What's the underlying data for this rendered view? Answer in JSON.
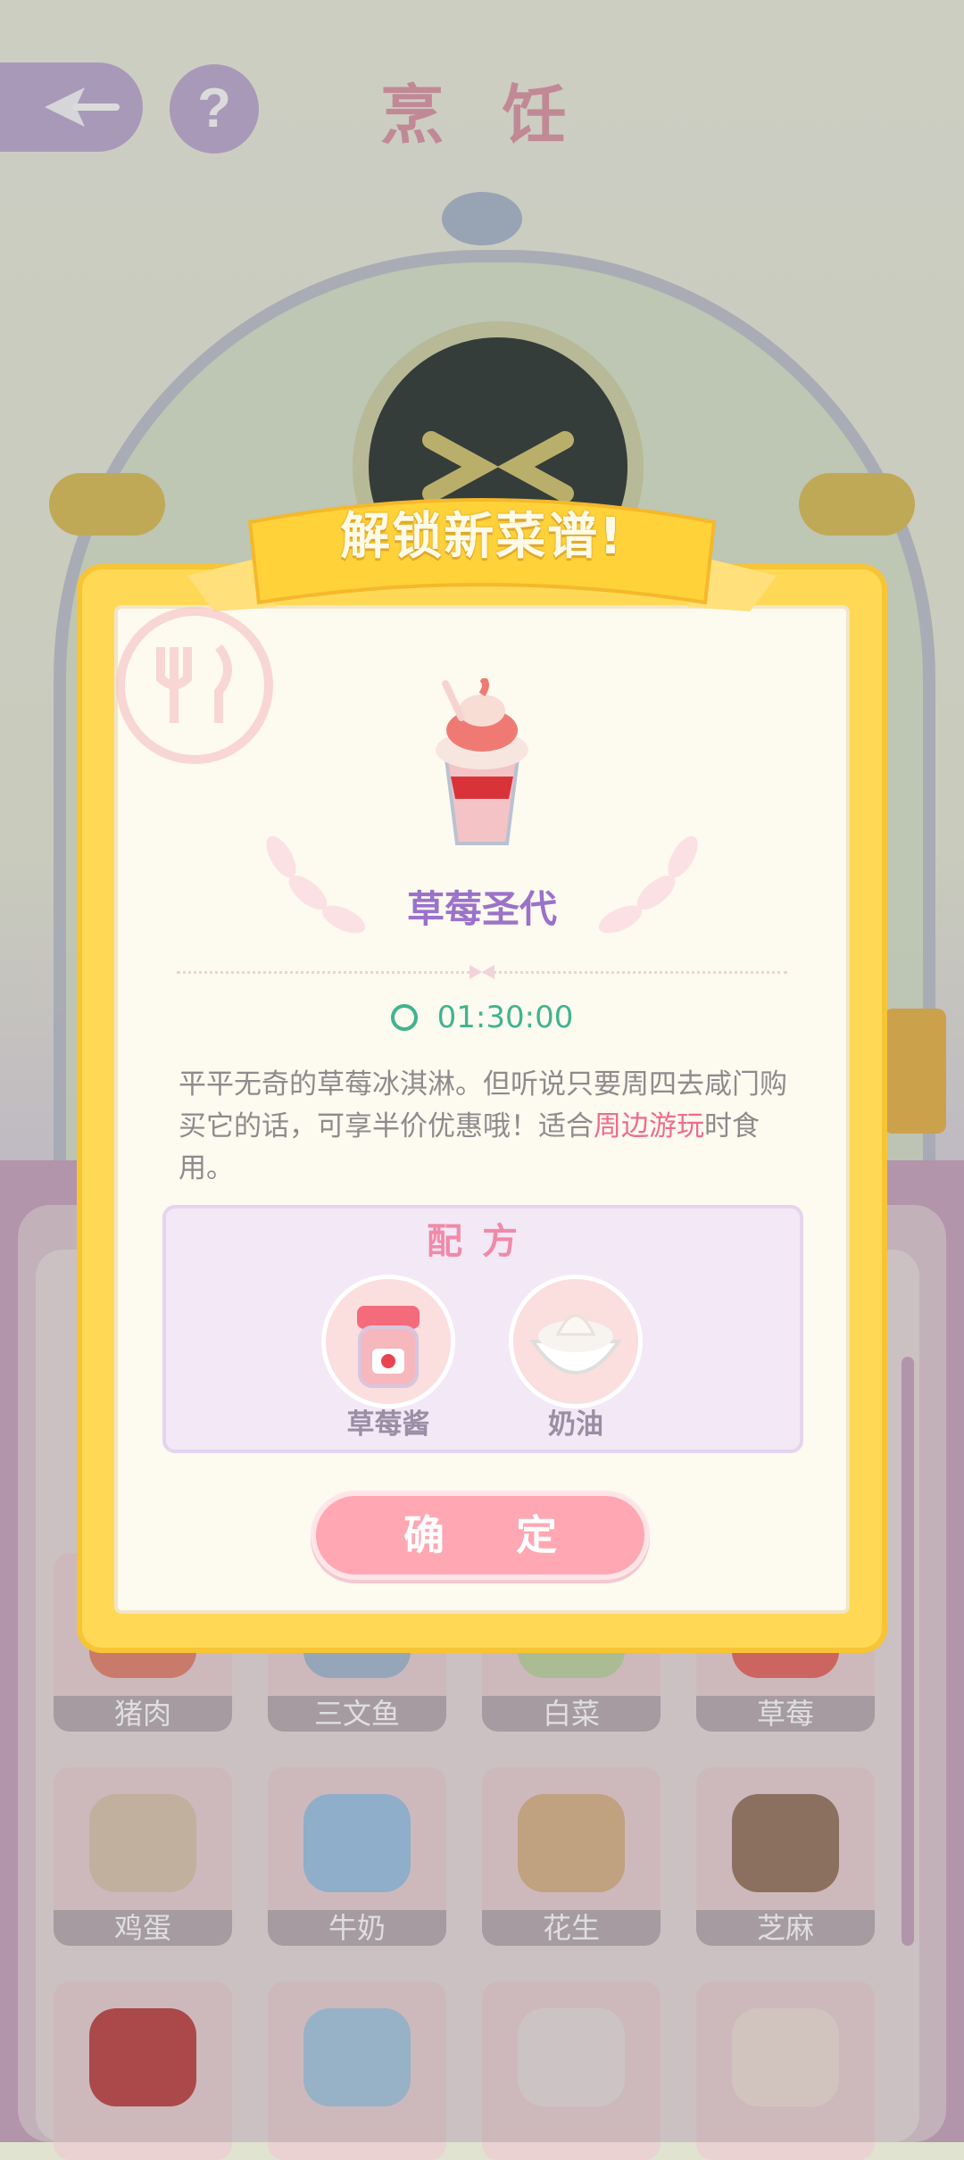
{
  "header": {
    "title": "烹 饪"
  },
  "background_tiles": [
    {
      "label": "猪肉",
      "color": "#e27a5f"
    },
    {
      "label": "三文鱼",
      "color": "#9ab7cf"
    },
    {
      "label": "白菜",
      "color": "#b9d79b"
    },
    {
      "label": "草莓",
      "color": "#e75a4e"
    },
    {
      "label": "鸡蛋",
      "color": "#d9c6a9"
    },
    {
      "label": "牛奶",
      "color": "#8fc3e6"
    },
    {
      "label": "花生",
      "color": "#d6b07c"
    },
    {
      "label": "芝麻",
      "color": "#8b6a4f"
    },
    {
      "label": "",
      "color": "#b8332f"
    },
    {
      "label": "",
      "color": "#9cc7e3"
    },
    {
      "label": "",
      "color": "#e8e2df"
    },
    {
      "label": "",
      "color": "#efe3d6"
    }
  ],
  "modal": {
    "banner": "解锁新菜谱!",
    "dish_name": "草莓圣代",
    "timer": "01:30:00",
    "description_pre": "平平无奇的草莓冰淇淋。但听说只要周四去咸门购买它的话，可享半价优惠哦！适合",
    "description_highlight": "周边游玩",
    "description_post": "时食用。",
    "recipe_title": "配方",
    "ingredients": [
      {
        "name": "草莓酱"
      },
      {
        "name": "奶油"
      }
    ],
    "confirm_label": "确 定"
  }
}
